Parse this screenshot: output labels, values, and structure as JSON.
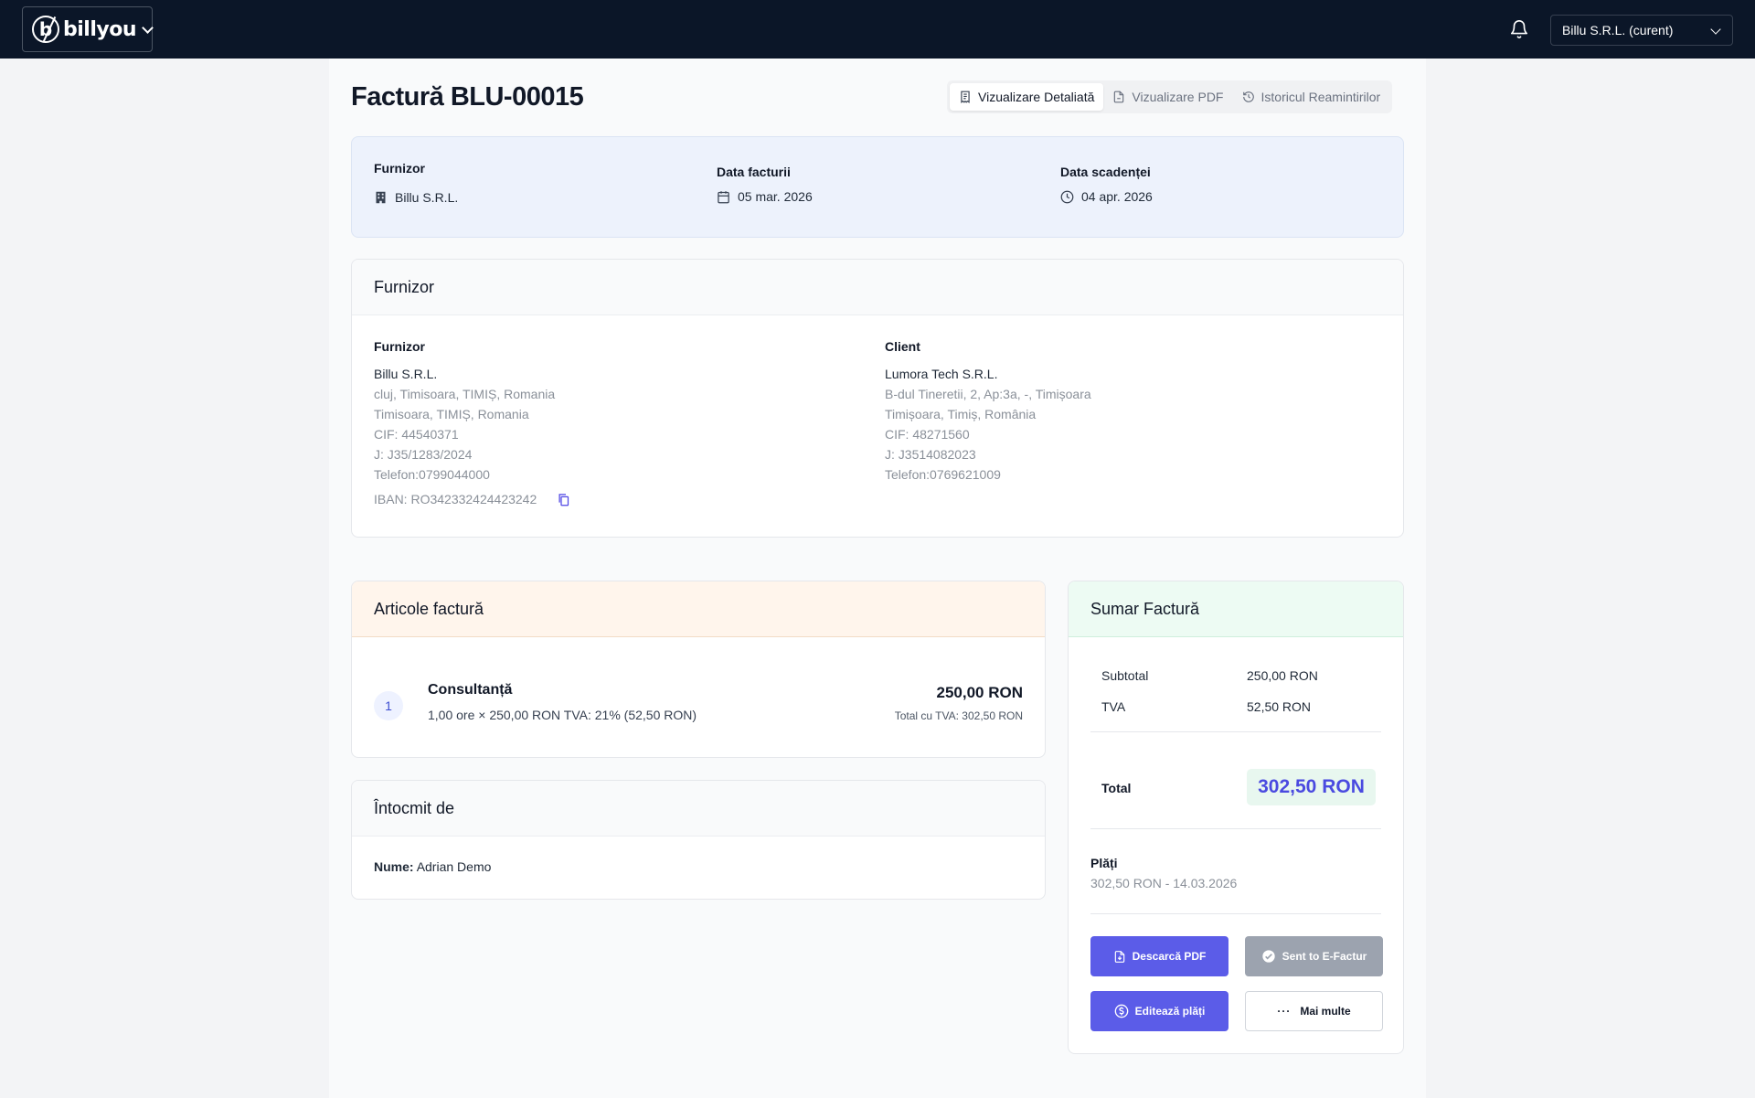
{
  "topbar": {
    "logo_text": "billyou",
    "logo_mark": "b",
    "company_selector": "Billu S.R.L. (curent)"
  },
  "page": {
    "title": "Factură BLU-00015",
    "tabs": [
      {
        "label": "Vizualizare Detaliată",
        "icon": "receipt-icon",
        "active": true
      },
      {
        "label": "Vizualizare PDF",
        "icon": "file-pdf-icon",
        "active": false
      },
      {
        "label": "Istoricul Reamintirilor",
        "icon": "history-icon",
        "active": false
      }
    ]
  },
  "info": {
    "supplier_label": "Furnizor",
    "supplier_value": "Billu S.R.L.",
    "invoice_date_label": "Data facturii",
    "invoice_date_value": "05 mar. 2026",
    "due_date_label": "Data scadenței",
    "due_date_value": "04 apr. 2026"
  },
  "parties": {
    "card_title": "Furnizor",
    "supplier": {
      "title": "Furnizor",
      "name": "Billu S.R.L.",
      "lines": [
        "cluj, Timisoara, TIMIȘ, Romania",
        "Timisoara, TIMIȘ, Romania",
        "CIF: 44540371",
        "J: J35/1283/2024",
        "Telefon:0799044000"
      ],
      "iban": "IBAN: RO342332424423242"
    },
    "client": {
      "title": "Client",
      "name": "Lumora Tech S.R.L.",
      "lines": [
        "B-dul Tineretii, 2, Ap:3a, -, Timișoara",
        "Timișoara, Timiș, România",
        "CIF: 48271560",
        "J: J3514082023",
        "Telefon:0769621009"
      ]
    }
  },
  "items": {
    "title": "Articole factură",
    "rows": [
      {
        "num": "1",
        "name": "Consultanță",
        "desc": "1,00 ore × 250,00 RON TVA: 21% (52,50 RON)",
        "total": "250,00 RON",
        "total_vat": "Total cu TVA: 302,50 RON"
      }
    ]
  },
  "author": {
    "title": "Întocmit de",
    "name_label": "Nume:",
    "name_value": "Adrian Demo"
  },
  "summary": {
    "title": "Sumar Factură",
    "subtotal_label": "Subtotal",
    "subtotal_value": "250,00 RON",
    "vat_label": "TVA",
    "vat_value": "52,50 RON",
    "total_label": "Total",
    "total_value": "302,50 RON",
    "payments_label": "Plăți",
    "payments_line": "302,50 RON - 14.03.2026",
    "buttons": {
      "download_pdf": "Descarcă PDF",
      "sent_efactura": "Sent to E-Factur",
      "edit_payments": "Editează plăți",
      "more": "Mai multe"
    }
  },
  "colors": {
    "topbar_bg": "#0b1628",
    "accent": "#5b5ce8",
    "info_card_bg": "#edf2fc",
    "items_header_bg": "#fff5ec",
    "summary_header_bg": "#edfbf3"
  }
}
